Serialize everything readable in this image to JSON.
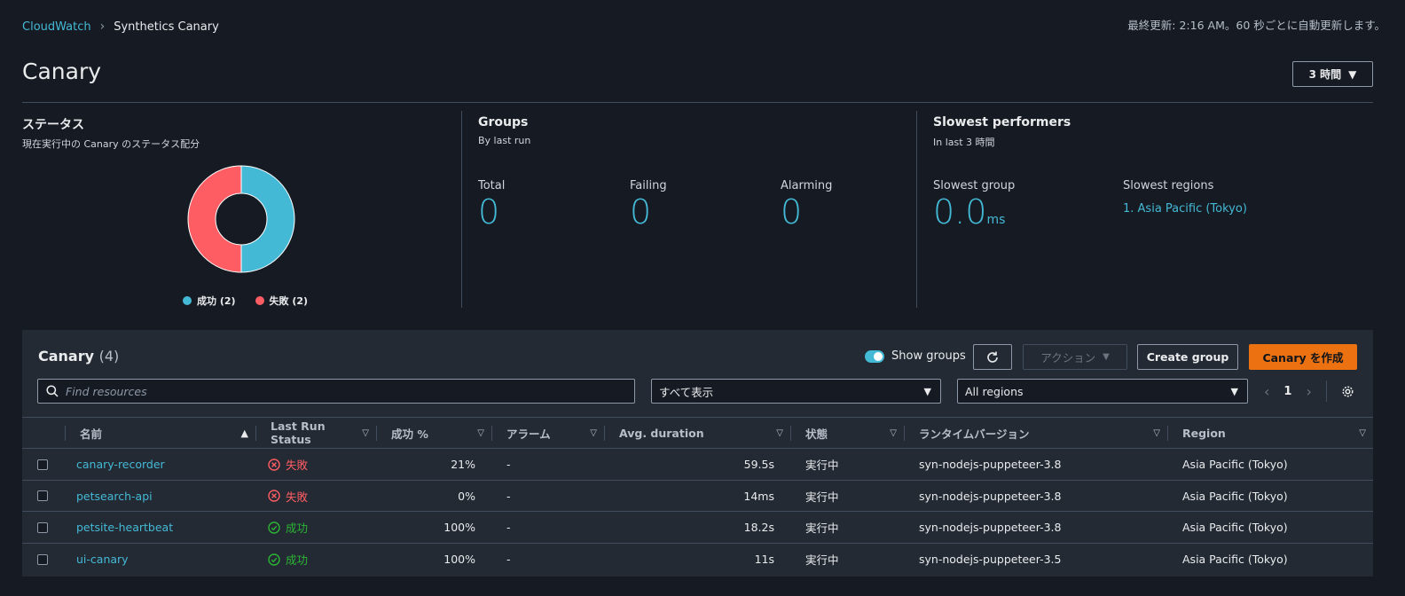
{
  "breadcrumb": {
    "root": "CloudWatch",
    "current": "Synthetics Canary"
  },
  "header": {
    "auto_refresh": "最終更新: 2:16 AM。60 秒ごとに自動更新します。",
    "title": "Canary",
    "time_range": "3 時間"
  },
  "status_section": {
    "title": "ステータス",
    "subtitle": "現在実行中の Canary のステータス配分",
    "legend": [
      {
        "label": "成功 (2)",
        "color": "#44b9d6",
        "value": 2
      },
      {
        "label": "失敗 (2)",
        "color": "#ff5d64",
        "value": 2
      }
    ]
  },
  "groups_section": {
    "title": "Groups",
    "subtitle": "By last run",
    "metrics": [
      {
        "label": "Total",
        "value": "0"
      },
      {
        "label": "Failing",
        "value": "0"
      },
      {
        "label": "Alarming",
        "value": "0"
      }
    ]
  },
  "slowest_section": {
    "title": "Slowest performers",
    "subtitle": "In last 3 時間",
    "group_label": "Slowest group",
    "group_value": "0.0",
    "group_unit": "ms",
    "regions_label": "Slowest regions",
    "region_link": "1. Asia Pacific (Tokyo)"
  },
  "panel": {
    "title": "Canary",
    "count": "(4)",
    "show_groups_label": "Show groups",
    "actions_label": "アクション",
    "create_group_label": "Create group",
    "create_canary_label": "Canary を作成",
    "search_placeholder": "Find resources",
    "filter_value": "すべて表示",
    "region_value": "All regions",
    "page": "1"
  },
  "table": {
    "columns": [
      "名前",
      "Last Run Status",
      "成功 %",
      "アラーム",
      "Avg. duration",
      "状態",
      "ランタイムバージョン",
      "Region"
    ],
    "rows": [
      {
        "name": "canary-recorder",
        "status": "失敗",
        "status_kind": "fail",
        "success": "21%",
        "alarm": "-",
        "duration": "59.5s",
        "state": "実行中",
        "runtime": "syn-nodejs-puppeteer-3.8",
        "region": "Asia Pacific (Tokyo)"
      },
      {
        "name": "petsearch-api",
        "status": "失敗",
        "status_kind": "fail",
        "success": "0%",
        "alarm": "-",
        "duration": "14ms",
        "state": "実行中",
        "runtime": "syn-nodejs-puppeteer-3.8",
        "region": "Asia Pacific (Tokyo)"
      },
      {
        "name": "petsite-heartbeat",
        "status": "成功",
        "status_kind": "pass",
        "success": "100%",
        "alarm": "-",
        "duration": "18.2s",
        "state": "実行中",
        "runtime": "syn-nodejs-puppeteer-3.8",
        "region": "Asia Pacific (Tokyo)"
      },
      {
        "name": "ui-canary",
        "status": "成功",
        "status_kind": "pass",
        "success": "100%",
        "alarm": "-",
        "duration": "11s",
        "state": "実行中",
        "runtime": "syn-nodejs-puppeteer-3.5",
        "region": "Asia Pacific (Tokyo)"
      }
    ]
  }
}
